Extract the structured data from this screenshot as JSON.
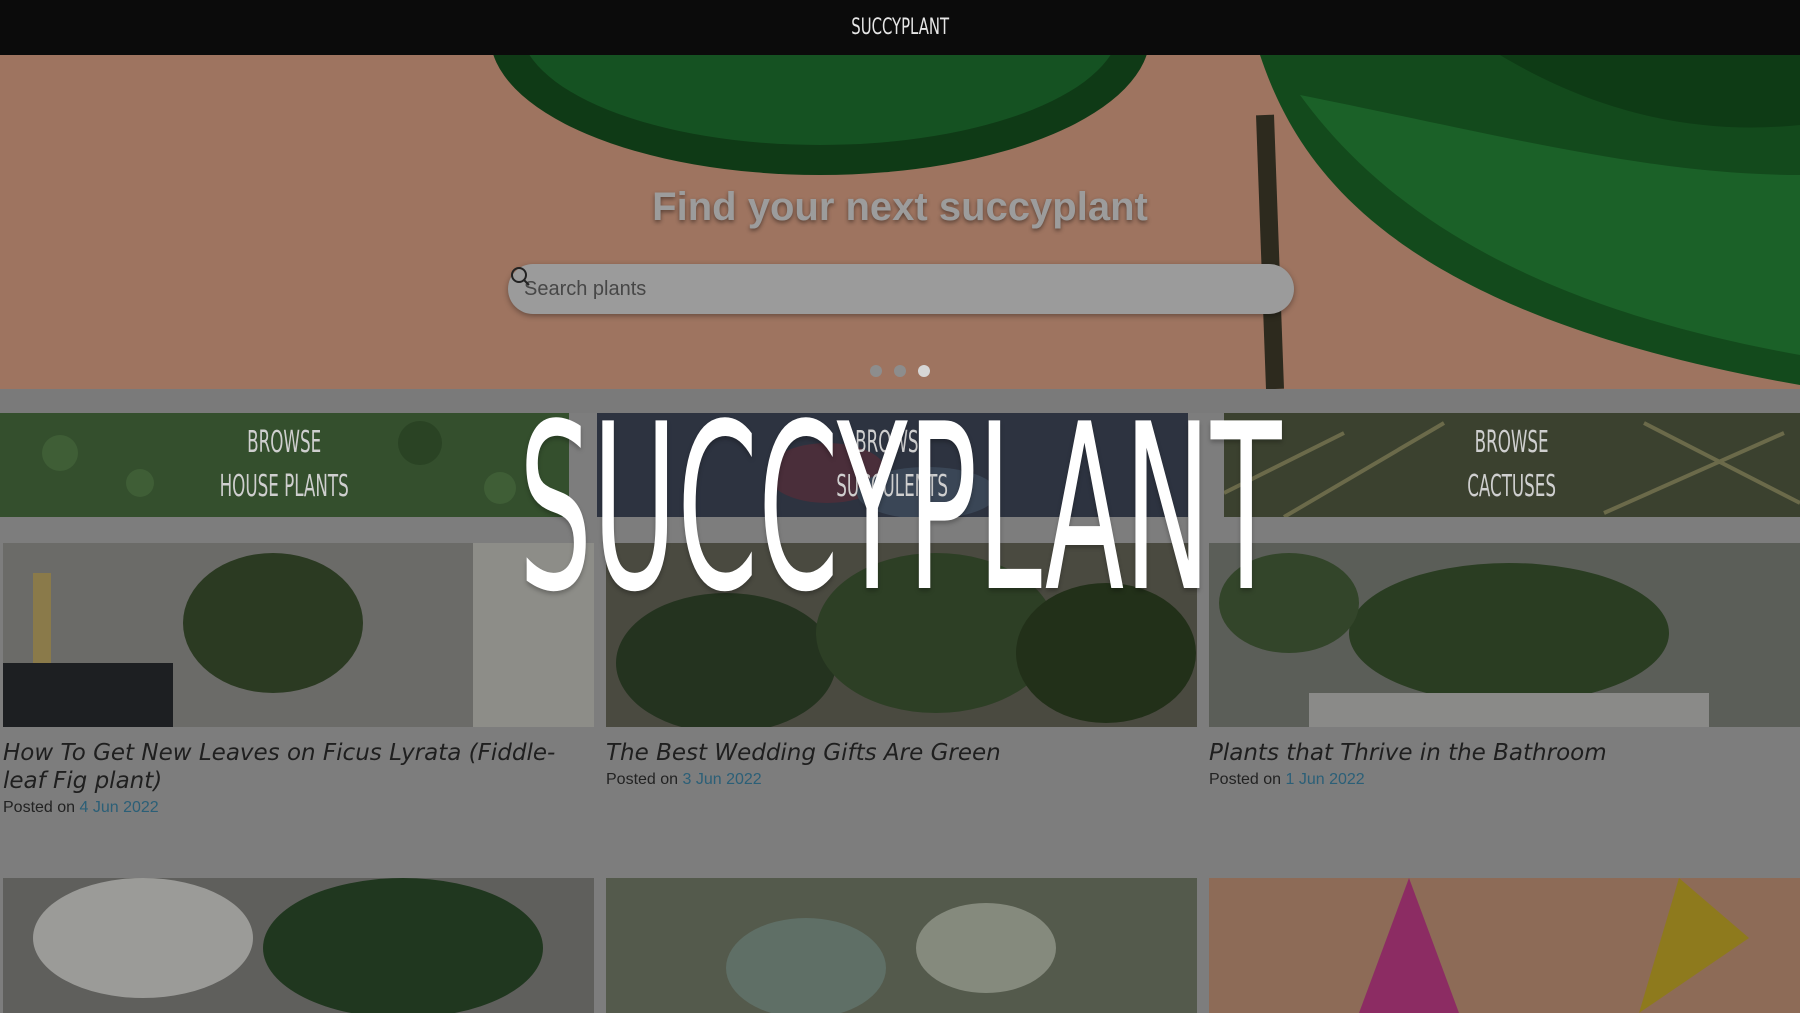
{
  "header": {
    "brand": "SUCCYPLANT"
  },
  "hero": {
    "title": "Find your next succyplant",
    "search_placeholder": "Search plants",
    "slides": 3,
    "active_slide": 3
  },
  "browse": [
    {
      "line1": "BROWSE",
      "line2": "HOUSE PLANTS"
    },
    {
      "line1": "BROWSE",
      "line2": "SUCCULENTS"
    },
    {
      "line1": "BROWSE",
      "line2": "CACTUSES"
    }
  ],
  "posts": [
    {
      "title": "How To Get New Leaves on Ficus Lyrata (Fiddle-leaf Fig plant)",
      "posted_prefix": "Posted on",
      "date": "4 Jun 2022"
    },
    {
      "title": "The Best Wedding Gifts Are Green",
      "posted_prefix": "Posted on",
      "date": "3 Jun 2022"
    },
    {
      "title": "Plants that Thrive in the Bathroom",
      "posted_prefix": "Posted on",
      "date": "1 Jun 2022"
    }
  ],
  "overlay": {
    "title": "SUCCYPLANT"
  },
  "colors": {
    "topbar": "#0b0b0b",
    "hero_bg": "#a07560",
    "link": "#2b5f77",
    "overlay_text": "#ffffff"
  }
}
